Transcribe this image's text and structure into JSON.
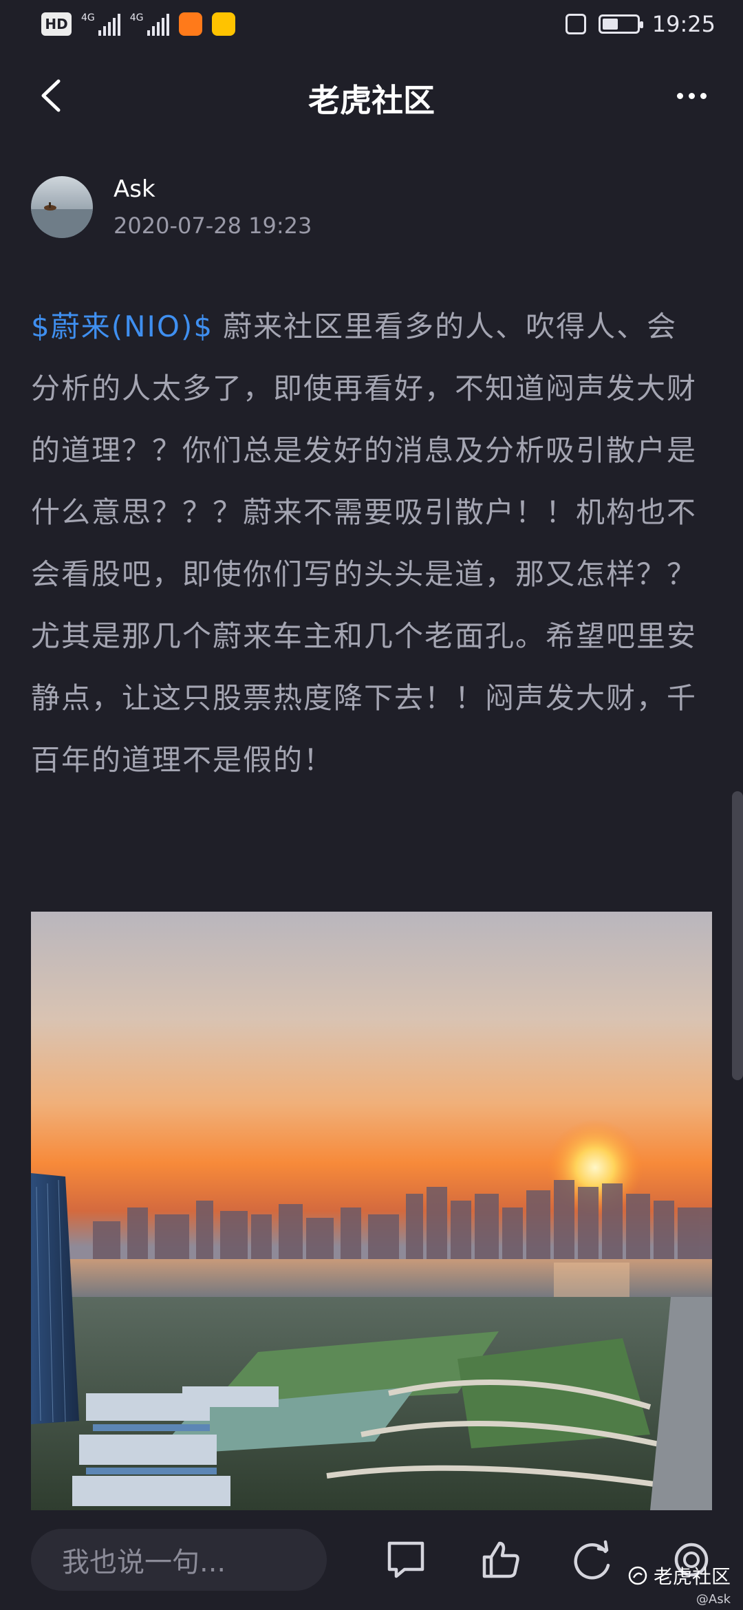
{
  "status_bar": {
    "hd_label": "HD",
    "sim1_label": "4G",
    "sim2_label": "4G",
    "battery_percent": 45,
    "time": "19:25"
  },
  "nav": {
    "title": "老虎社区",
    "back_icon": "chevron-left-icon",
    "more_icon": "more-dots-icon"
  },
  "post": {
    "author_name": "Ask",
    "timestamp": "2020-07-28 19:23",
    "ticker": "$蔚来(NIO)$",
    "body": "蔚来社区里看多的人、吹得人、会分析的人太多了，即使再看好，不知道闷声发大财的道理？？你们总是发好的消息及分析吸引散户是什么意思？？？蔚来不需要吸引散户！！机构也不会看股吧，即使你们写的头头是道，那又怎样？？尤其是那几个蔚来车主和几个老面孔。希望吧里安静点，让这只股票热度降下去！！闷声发大财，千百年的道理不是假的！"
  },
  "bottom_bar": {
    "comment_placeholder": "我也说一句...",
    "comment_icon": "comment-icon",
    "like_icon": "thumbs-up-icon",
    "share_icon": "share-icon",
    "watermark_main": "老虎社区",
    "watermark_sub": "@Ask"
  },
  "colors": {
    "background": "#1f1f28",
    "ticker": "#3f8ff0",
    "body_text": "#a4a5b2"
  }
}
